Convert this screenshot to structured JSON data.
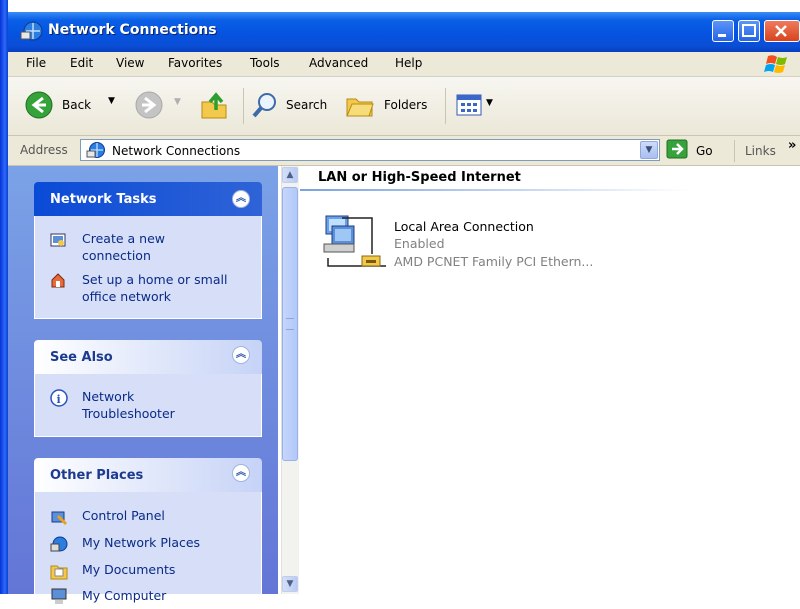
{
  "window": {
    "title": "Network Connections"
  },
  "menu": [
    "File",
    "Edit",
    "View",
    "Favorites",
    "Tools",
    "Advanced",
    "Help"
  ],
  "toolbar": {
    "back": "Back",
    "search": "Search",
    "folders": "Folders"
  },
  "address": {
    "label": "Address",
    "value": "Network Connections",
    "go": "Go",
    "links": "Links",
    "chevron": "»"
  },
  "tasks": {
    "network_tasks": {
      "title": "Network Tasks",
      "items": [
        "Create a new connection",
        "Set up a home or small office network"
      ]
    },
    "see_also": {
      "title": "See Also",
      "items": [
        "Network Troubleshooter"
      ]
    },
    "other_places": {
      "title": "Other Places",
      "items": [
        "Control Panel",
        "My Network Places",
        "My Documents",
        "My Computer"
      ]
    }
  },
  "content": {
    "group_header": "LAN or High-Speed Internet",
    "connection": {
      "name": "Local Area Connection",
      "status": "Enabled",
      "device": "AMD PCNET Family PCI Ethern..."
    }
  },
  "colors": {
    "titlebar": "#0553e0",
    "taskpane": "#6375d6",
    "link": "#0a2a88",
    "panel_body": "#d6dff7"
  }
}
